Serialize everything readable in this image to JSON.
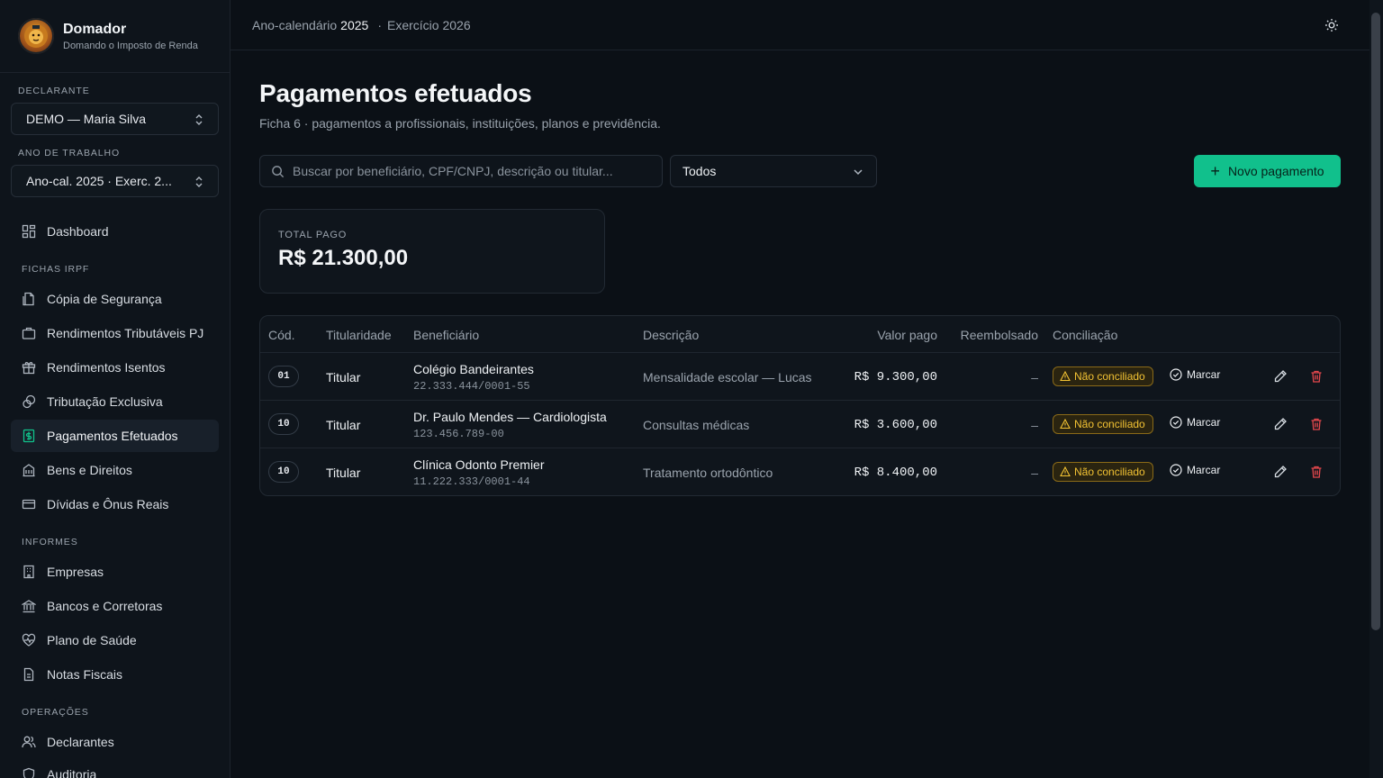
{
  "brand": {
    "name": "Domador",
    "tagline": "Domando o Imposto de Renda",
    "logo_icon": "lion-logo-icon"
  },
  "sidebar": {
    "declarante_label": "DECLARANTE",
    "declarante_value": "DEMO — Maria Silva",
    "ano_label": "ANO DE TRABALHO",
    "ano_value": "Ano-cal. 2025 · Exerc. 2...",
    "dashboard": "Dashboard",
    "group_fichas": "FICHAS IRPF",
    "fichas": [
      {
        "label": "Cópia de Segurança",
        "icon": "file-copy-icon"
      },
      {
        "label": "Rendimentos Tributáveis PJ",
        "icon": "briefcase-icon"
      },
      {
        "label": "Rendimentos Isentos",
        "icon": "gift-icon"
      },
      {
        "label": "Tributação Exclusiva",
        "icon": "coins-icon"
      },
      {
        "label": "Pagamentos Efetuados",
        "icon": "receipt-icon",
        "active": true
      },
      {
        "label": "Bens e Direitos",
        "icon": "building-icon"
      },
      {
        "label": "Dívidas e Ônus Reais",
        "icon": "credit-card-icon"
      }
    ],
    "group_informes": "INFORMES",
    "informes": [
      {
        "label": "Empresas",
        "icon": "office-icon"
      },
      {
        "label": "Bancos e Corretoras",
        "icon": "bank-icon"
      },
      {
        "label": "Plano de Saúde",
        "icon": "heart-pulse-icon"
      },
      {
        "label": "Notas Fiscais",
        "icon": "invoice-icon"
      }
    ],
    "group_operacoes": "OPERAÇÕES",
    "operacoes": [
      {
        "label": "Declarantes",
        "icon": "users-icon"
      },
      {
        "label": "Auditoria",
        "icon": "shield-icon"
      }
    ]
  },
  "topbar": {
    "ano_prefix": "Ano-calendário",
    "ano": "2025",
    "sep": "·",
    "exercicio": "Exercício 2026"
  },
  "page": {
    "title": "Pagamentos efetuados",
    "subtitle": "Ficha 6 · pagamentos a profissionais, instituições, planos e previdência.",
    "search_placeholder": "Buscar por beneficiário, CPF/CNPJ, descrição ou titular...",
    "filter_value": "Todos",
    "new_button": "Novo pagamento",
    "total_label": "TOTAL PAGO",
    "total_value": "R$ 21.300,00"
  },
  "table": {
    "headers": {
      "cod": "Cód.",
      "titularidade": "Titularidade",
      "beneficiario": "Beneficiário",
      "descricao": "Descrição",
      "valor": "Valor pago",
      "reembolsado": "Reembolsado",
      "conciliacao": "Conciliação"
    },
    "rows": [
      {
        "cod": "01",
        "titularidade": "Titular",
        "beneficiario": "Colégio Bandeirantes",
        "doc": "22.333.444/0001-55",
        "descricao": "Mensalidade escolar — Lucas",
        "valor": "R$ 9.300,00",
        "reembolsado": "–",
        "status": "Não conciliado",
        "action": "Marcar"
      },
      {
        "cod": "10",
        "titularidade": "Titular",
        "beneficiario": "Dr. Paulo Mendes — Cardiologista",
        "doc": "123.456.789-00",
        "descricao": "Consultas médicas",
        "valor": "R$ 3.600,00",
        "reembolsado": "–",
        "status": "Não conciliado",
        "action": "Marcar"
      },
      {
        "cod": "10",
        "titularidade": "Titular",
        "beneficiario": "Clínica Odonto Premier",
        "doc": "11.222.333/0001-44",
        "descricao": "Tratamento ortodôntico",
        "valor": "R$ 8.400,00",
        "reembolsado": "–",
        "status": "Não conciliado",
        "action": "Marcar"
      }
    ]
  },
  "colors": {
    "accent": "#11c08c",
    "warning": "#f2c233",
    "danger": "#e5484d",
    "background": "#0b1016"
  }
}
